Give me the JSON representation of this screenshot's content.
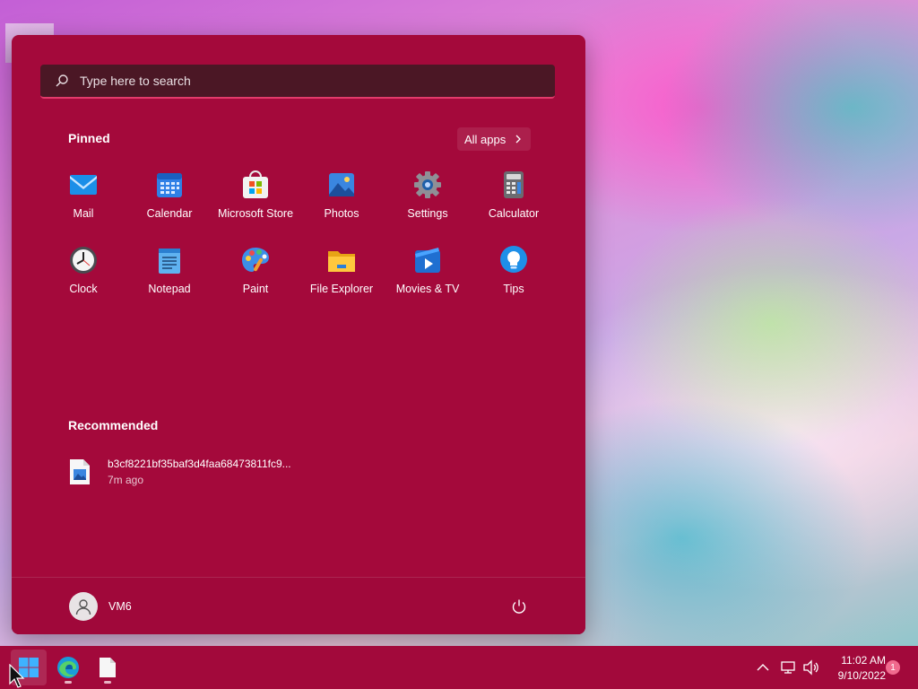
{
  "search": {
    "placeholder": "Type here to search"
  },
  "pinned": {
    "title": "Pinned",
    "all_apps_label": "All apps",
    "apps": [
      {
        "label": "Mail",
        "icon": "mail-icon"
      },
      {
        "label": "Calendar",
        "icon": "calendar-icon"
      },
      {
        "label": "Microsoft Store",
        "icon": "store-icon"
      },
      {
        "label": "Photos",
        "icon": "photos-icon"
      },
      {
        "label": "Settings",
        "icon": "gear-icon"
      },
      {
        "label": "Calculator",
        "icon": "calculator-icon"
      },
      {
        "label": "Clock",
        "icon": "clock-icon"
      },
      {
        "label": "Notepad",
        "icon": "notepad-icon"
      },
      {
        "label": "Paint",
        "icon": "palette-icon"
      },
      {
        "label": "File Explorer",
        "icon": "folder-icon"
      },
      {
        "label": "Movies & TV",
        "icon": "play-icon"
      },
      {
        "label": "Tips",
        "icon": "lightbulb-icon"
      }
    ]
  },
  "recommended": {
    "title": "Recommended",
    "items": [
      {
        "name": "b3cf8221bf35baf3d4faa68473811fc9...",
        "time": "7m ago",
        "icon": "image-file-icon"
      }
    ]
  },
  "user": {
    "name": "VM6"
  },
  "taskbar": {
    "time": "11:02 AM",
    "date": "9/10/2022",
    "notification_count": "1"
  },
  "colors": {
    "accent": "#a4093b",
    "search_bg": "#4b1725",
    "search_underline": "#e23b6b"
  }
}
